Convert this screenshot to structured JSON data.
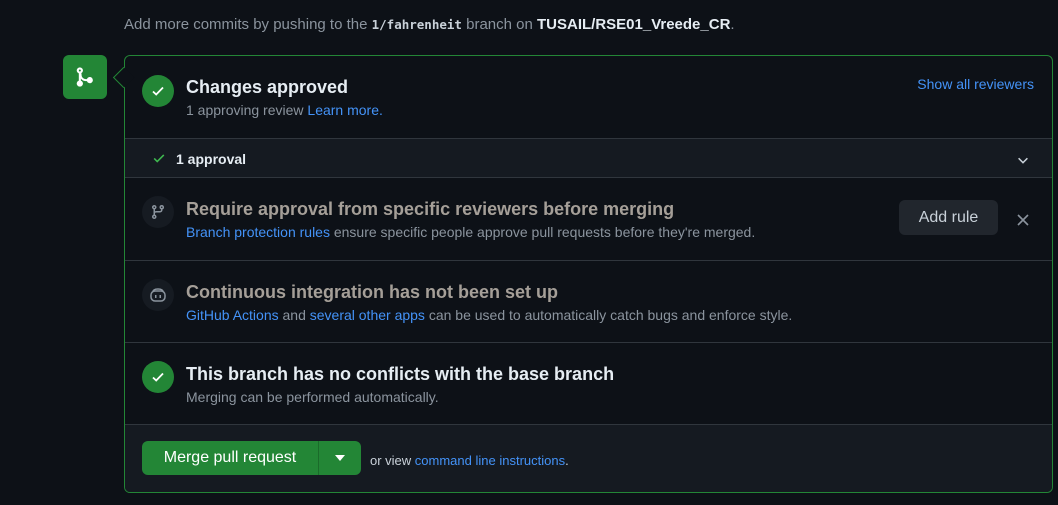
{
  "header_note": {
    "prefix": "Add more commits by pushing to the ",
    "branch": "1/fahrenheit",
    "middle": " branch on ",
    "repo": "TUSAIL/RSE01_Vreede_CR",
    "suffix": "."
  },
  "approved": {
    "title": "Changes approved",
    "subtitle": "1 approving review ",
    "learn_more": "Learn more.",
    "show_all": "Show all reviewers",
    "approvals_label": "1 approval"
  },
  "require": {
    "title": "Require approval from specific reviewers before merging",
    "link": "Branch protection rules",
    "text": " ensure specific people approve pull requests before they're merged.",
    "add_rule": "Add rule"
  },
  "ci": {
    "title": "Continuous integration has not been set up",
    "link1": "GitHub Actions",
    "and": " and ",
    "link2": "several other apps",
    "text": " can be used to automatically catch bugs and enforce style."
  },
  "conflicts": {
    "title": "This branch has no conflicts with the base branch",
    "subtitle": "Merging can be performed automatically."
  },
  "merge": {
    "button": "Merge pull request",
    "or_view": "or view ",
    "cli_link": "command line instructions",
    "suffix": "."
  },
  "colors": {
    "success": "#238636",
    "link": "#4493f8",
    "background": "#0d1117"
  }
}
